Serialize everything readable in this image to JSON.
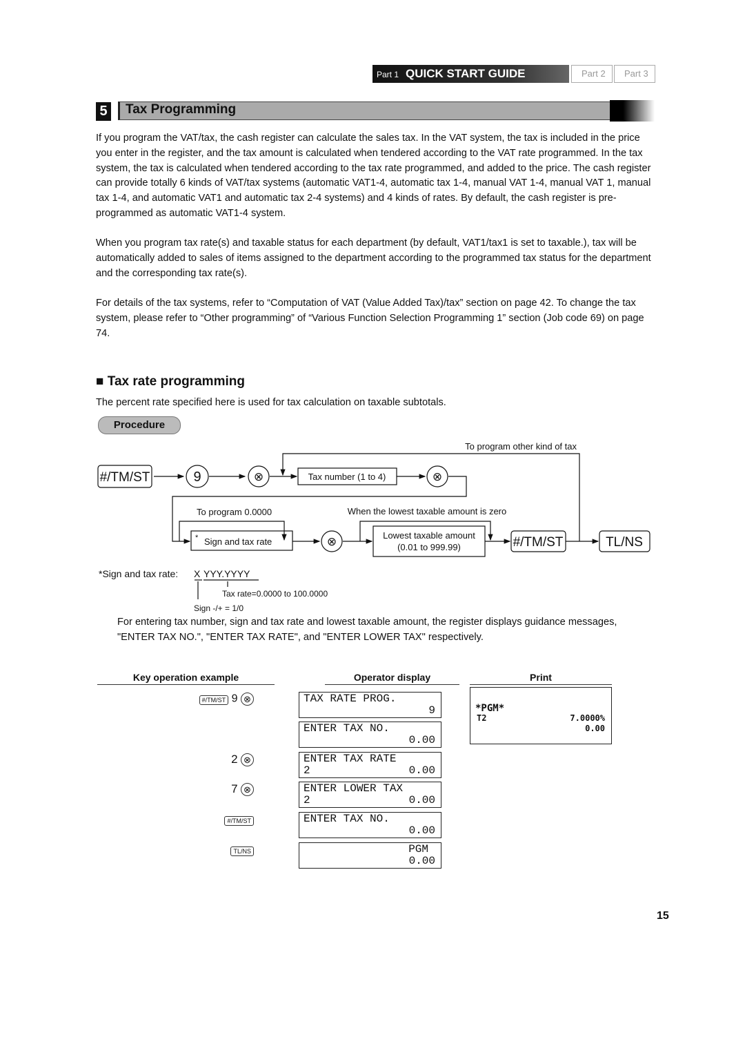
{
  "nav": {
    "part1_prefix": "Part 1",
    "part1_title": "QUICK START GUIDE",
    "part2": "Part 2",
    "part3": "Part 3"
  },
  "section": {
    "number": "5",
    "title": "Tax Programming"
  },
  "paragraphs": [
    "If you program the VAT/tax, the cash register can calculate the sales tax.  In the VAT system, the tax is included in the price you enter in the register, and the tax amount is calculated when tendered according to the VAT rate programmed.  In the tax system, the tax is calculated when tendered according to the tax rate programmed, and added to the price. The cash register can provide totally 6 kinds of VAT/tax systems (automatic VAT1-4, automatic tax 1-4, manual VAT 1-4, manual VAT 1, manual tax 1-4, and automatic VAT1 and automatic tax 2-4 systems) and 4 kinds of rates.  By default, the cash register is pre-programmed as automatic VAT1-4 system.",
    "When you program tax rate(s) and taxable status for each department (by default, VAT1/tax1 is set to taxable.), tax will be automatically added to sales of items assigned to the department according to the programmed tax status for the department and the corresponding tax rate(s).",
    "For details of the tax systems, refer to “Computation of VAT (Value Added Tax)/tax” section on page 42.  To change the tax system, please refer to “Other programming” of “Various Function Selection Programming 1” section (Job code 69) on page 74."
  ],
  "subsection": {
    "title": "Tax rate programming",
    "intro": "The percent rate specified here is used for tax calculation on taxable subtotals.",
    "procedure_label": "Procedure"
  },
  "diagram": {
    "key_tm_st": "#/TM/ST",
    "key_9": "9",
    "multiply": "⊗",
    "tax_number": "Tax number (1 to 4)",
    "loop_label": "To program other kind of tax",
    "bypass_zero": "To program  0.0000",
    "sign_rate": "Sign and tax rate",
    "asterisk": "*",
    "bypass_lowest": "When the lowest taxable amount is zero",
    "lowest_1": "Lowest taxable amount",
    "lowest_2": "(0.01 to 999.99)",
    "key_tl_ns": "TL/NS"
  },
  "format": {
    "label": "*Sign and tax rate: ",
    "x": "X",
    "y": "YYY.YYYY",
    "rate_note": "Tax rate=0.0000 to 100.0000",
    "sign_note": "Sign -/+ = 1/0"
  },
  "guidance": "For entering tax number, sign and tax rate and lowest taxable amount, the register displays guidance messages, \"ENTER TAX NO.\", \"ENTER TAX RATE\", and \"ENTER LOWER TAX\" respectively.",
  "example": {
    "headers": {
      "key": "Key operation example",
      "display": "Operator display",
      "print": "Print"
    },
    "keys": [
      {
        "key": "#/TM/ST",
        "num": "9",
        "op": "⊗"
      },
      {
        "num": "2",
        "op": "⊗"
      },
      {
        "num": "7",
        "op": "⊗"
      },
      {
        "key": "#/TM/ST"
      },
      {
        "key": "TL/NS"
      }
    ],
    "displays": [
      {
        "l1": "TAX RATE PROG.",
        "l2l": "",
        "l2r": "9"
      },
      {
        "l1": "ENTER TAX NO.",
        "l2l": "",
        "l2r": "0.00"
      },
      {
        "l1": "ENTER TAX RATE",
        "l2l": "2",
        "l2r": "0.00"
      },
      {
        "l1": "ENTER LOWER TAX",
        "l2l": "2",
        "l2r": "0.00"
      },
      {
        "l1": "ENTER TAX NO.",
        "l2l": "",
        "l2r": "0.00"
      },
      {
        "l1": "",
        "l2l": "",
        "l2r": "0.00",
        "l1r": "PGM"
      }
    ],
    "print": {
      "header": "*PGM*",
      "tax": "T2",
      "rate": "7.0000%",
      "amount": "0.00"
    }
  },
  "page_number": "15"
}
